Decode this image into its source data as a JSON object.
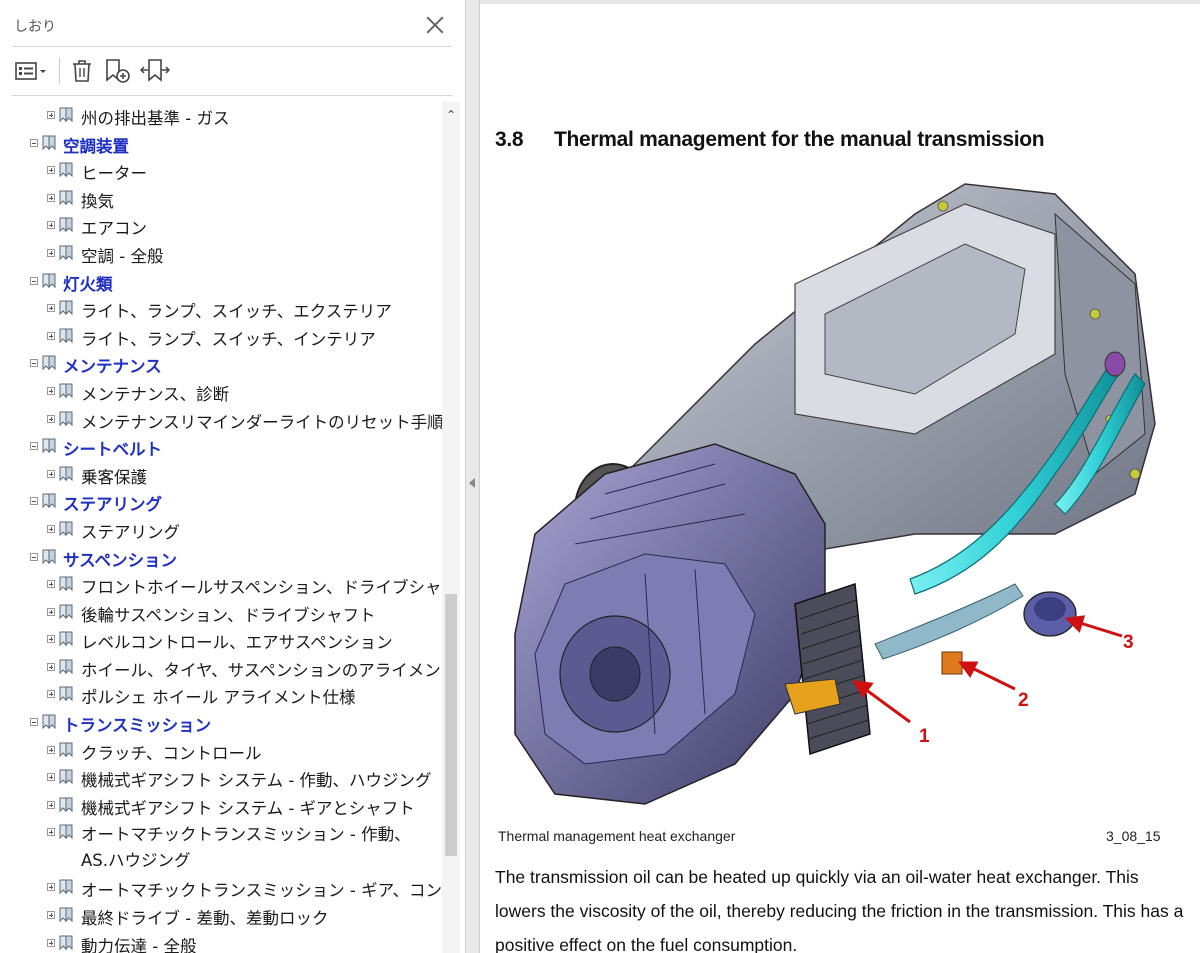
{
  "panel": {
    "title": "しおり",
    "toolbar": {
      "options_icon": "list-options-icon",
      "delete_icon": "trash-icon",
      "new_bookmark_icon": "new-bookmark-icon",
      "expand_icon": "expand-bookmark-icon"
    },
    "items": [
      {
        "level": 2,
        "label": "州の排出基準 - ガス"
      },
      {
        "level": 1,
        "label": "空調装置"
      },
      {
        "level": 2,
        "label": "ヒーター"
      },
      {
        "level": 2,
        "label": "換気"
      },
      {
        "level": 2,
        "label": "エアコン"
      },
      {
        "level": 2,
        "label": "空調 - 全般"
      },
      {
        "level": 1,
        "label": "灯火類"
      },
      {
        "level": 2,
        "label": "ライト、ランプ、スイッチ、エクステリア"
      },
      {
        "level": 2,
        "label": "ライト、ランプ、スイッチ、インテリア"
      },
      {
        "level": 1,
        "label": "メンテナンス"
      },
      {
        "level": 2,
        "label": "メンテナンス、診断"
      },
      {
        "level": 2,
        "label": "メンテナンスリマインダーライトのリセット手順"
      },
      {
        "level": 1,
        "label": "シートベルト"
      },
      {
        "level": 2,
        "label": "乗客保護"
      },
      {
        "level": 1,
        "label": "ステアリング"
      },
      {
        "level": 2,
        "label": "ステアリング"
      },
      {
        "level": 1,
        "label": "サスペンション"
      },
      {
        "level": 2,
        "label": "フロントホイールサスペンション、ドライブシャフト"
      },
      {
        "level": 2,
        "label": "後輪サスペンション、ドライブシャフト"
      },
      {
        "level": 2,
        "label": "レベルコントロール、エアサスペンション"
      },
      {
        "level": 2,
        "label": "ホイール、タイヤ、サスペンションのアライメント"
      },
      {
        "level": 2,
        "label": "ポルシェ ホイール アライメント仕様"
      },
      {
        "level": 1,
        "label": "トランスミッション"
      },
      {
        "level": 2,
        "label": "クラッチ、コントロール"
      },
      {
        "level": 2,
        "label": "機械式ギアシフト システム - 作動、ハウジング"
      },
      {
        "level": 2,
        "label": "機械式ギアシフト システム - ギアとシャフト"
      },
      {
        "level": 2,
        "label": "オートマチックトランスミッション - 作動、AS.ハウジング",
        "wrap": true
      },
      {
        "level": 2,
        "label": "オートマチックトランスミッション - ギア、コントロール"
      },
      {
        "level": 2,
        "label": "最終ドライブ - 差動、差動ロック"
      },
      {
        "level": 2,
        "label": "動力伝達 - 全般"
      }
    ]
  },
  "document": {
    "section_number": "3.8",
    "section_title": "Thermal management for the manual transmission",
    "figure": {
      "callouts": [
        "1",
        "2",
        "3"
      ],
      "caption": "Thermal management heat exchanger",
      "figure_id": "3_08_15"
    },
    "body": "The transmission oil can be heated up quickly via an oil-water heat exchanger. This lowers the viscosity of the oil, thereby reducing the friction in the transmission. This has a positive effect on the fuel consumption."
  },
  "colors": {
    "chapter_link": "#1f2fc4",
    "callout_red": "#d01010",
    "pipe_cyan": "#2fd0d6"
  }
}
